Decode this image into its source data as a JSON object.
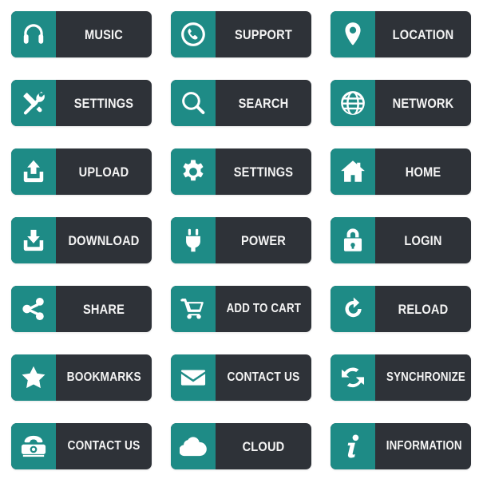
{
  "theme": {
    "icon_panel_color": "#1e8b86",
    "label_panel_color": "#2e3238",
    "label_text_color": "#f4f4f4",
    "icon_color": "#ffffff",
    "page_background": "#ffffff"
  },
  "grid": {
    "columns": 3,
    "rows": 7,
    "total_buttons": 21
  },
  "buttons": [
    {
      "label": "MUSIC",
      "icon": "headphones-icon"
    },
    {
      "label": "SUPPORT",
      "icon": "phone-handset-circle-icon"
    },
    {
      "label": "LOCATION",
      "icon": "map-pin-icon"
    },
    {
      "label": "SETTINGS",
      "icon": "wrench-screwdriver-icon"
    },
    {
      "label": "SEARCH",
      "icon": "magnifier-icon"
    },
    {
      "label": "NETWORK",
      "icon": "globe-icon"
    },
    {
      "label": "UPLOAD",
      "icon": "upload-tray-icon"
    },
    {
      "label": "SETTINGS",
      "icon": "gear-icon"
    },
    {
      "label": "HOME",
      "icon": "house-icon"
    },
    {
      "label": "DOWNLOAD",
      "icon": "download-tray-icon"
    },
    {
      "label": "POWER",
      "icon": "power-plug-icon"
    },
    {
      "label": "LOGIN",
      "icon": "padlock-icon"
    },
    {
      "label": "SHARE",
      "icon": "share-nodes-icon"
    },
    {
      "label": "ADD TO CART",
      "icon": "shopping-cart-icon"
    },
    {
      "label": "RELOAD",
      "icon": "refresh-arrow-icon"
    },
    {
      "label": "BOOKMARKS",
      "icon": "star-icon"
    },
    {
      "label": "CONTACT US",
      "icon": "envelope-icon"
    },
    {
      "label": "SYNCHRONIZE",
      "icon": "sync-arrows-icon"
    },
    {
      "label": "CONTACT US",
      "icon": "rotary-telephone-icon"
    },
    {
      "label": "CLOUD",
      "icon": "cloud-icon"
    },
    {
      "label": "INFORMATION",
      "icon": "info-italic-i-icon"
    }
  ]
}
